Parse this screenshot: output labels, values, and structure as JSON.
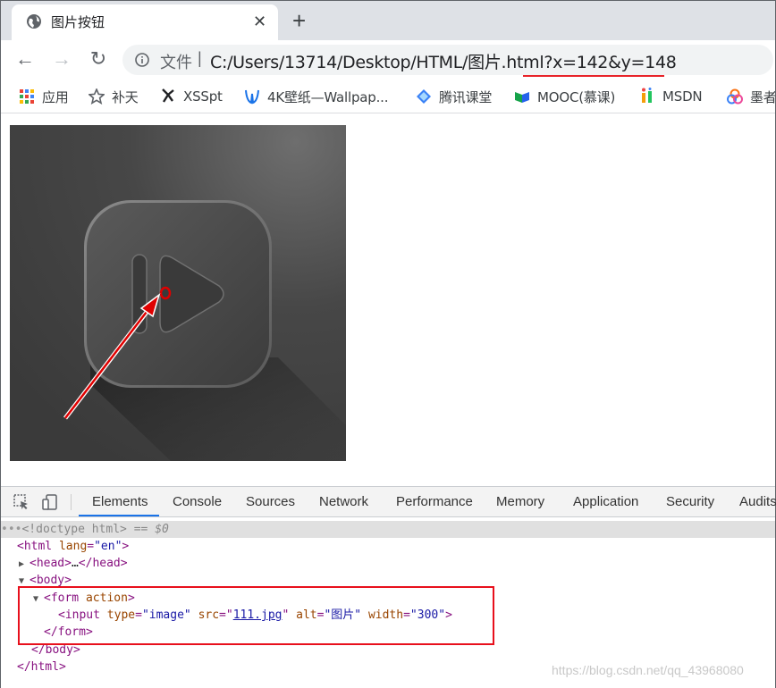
{
  "tab": {
    "title": "图片按钮",
    "close": "✕",
    "new_tab": "+"
  },
  "toolbar": {
    "back": "←",
    "forward": "→",
    "reload": "↻",
    "file_label": "文件",
    "separator": "|",
    "url": "C:/Users/13714/Desktop/HTML/图片.html?x=142&y=148"
  },
  "bookmarks": [
    {
      "icon": "apps-grid-icon",
      "label": "应用",
      "color": "#ea4335"
    },
    {
      "icon": "star-icon",
      "label": "补天",
      "color": "#5f6368"
    },
    {
      "icon": "xsspt-icon",
      "label": "XSSpt",
      "color": "#202124"
    },
    {
      "icon": "wallpaper-icon",
      "label": "4K壁纸—Wallpap...",
      "color": "#1a73e8"
    },
    {
      "icon": "tencent-classroom-icon",
      "label": "腾讯课堂",
      "color": "#3b82f6"
    },
    {
      "icon": "mooc-icon",
      "label": "MOOC(慕课)",
      "color": "#16a34a"
    },
    {
      "icon": "msdn-icon",
      "label": "MSDN",
      "color": "#f59e0b"
    },
    {
      "icon": "mozhe-icon",
      "label": "墨者",
      "color": "#f97316"
    }
  ],
  "devtools": {
    "tabs": [
      "Elements",
      "Console",
      "Sources",
      "Network",
      "Performance",
      "Memory",
      "Application",
      "Security",
      "Audits"
    ],
    "active_tab": "Elements",
    "dom": {
      "doctype": "<!doctype html>",
      "selected_marker": "== $0",
      "html_open_tag": "html",
      "html_lang_attr": "lang",
      "html_lang_val": "\"en\"",
      "head": "head",
      "head_ellipsis": "…",
      "body": "body",
      "form": "form",
      "form_attr": "action",
      "input": "input",
      "attr_type": "type",
      "val_type": "\"image\"",
      "attr_src": "src",
      "val_src": "111.jpg",
      "attr_alt": "alt",
      "val_alt": "\"图片\"",
      "attr_width": "width",
      "val_width": "\"300\""
    }
  },
  "watermark": "https://blog.csdn.net/qq_43968080"
}
